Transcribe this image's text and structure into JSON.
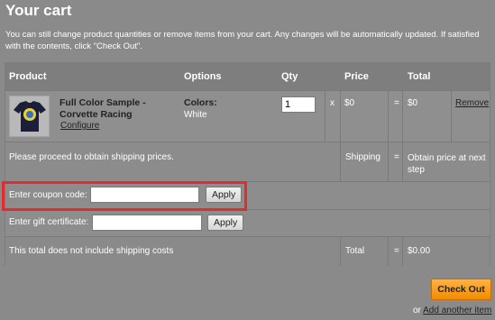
{
  "page": {
    "title": "Your cart",
    "intro": "You can still change product quantities or remove items from your cart. Any changes will be automatically updated. If satisfied with the contents, click \"Check Out\"."
  },
  "table": {
    "headers": {
      "product": "Product",
      "options": "Options",
      "qty": "Qty",
      "price": "Price",
      "total": "Total"
    },
    "item": {
      "name": "Full Color Sample - Corvette Racing",
      "configure": "Configure",
      "option_label": "Colors:",
      "option_value": "White",
      "qty": "1",
      "times": "x",
      "price": "$0",
      "equals": "=",
      "total": "$0",
      "remove": "Remove"
    },
    "shipping": {
      "message": "Please proceed to obtain shipping prices.",
      "label": "Shipping",
      "equals": "=",
      "value": "Obtain price at next step"
    },
    "coupon": {
      "label": "Enter coupon code:",
      "value": "",
      "apply": "Apply"
    },
    "gift": {
      "label": "Enter gift certificate:",
      "value": "",
      "apply": "Apply"
    },
    "total": {
      "note": "This total does not include shipping costs",
      "label": "Total",
      "equals": "=",
      "value": "$0.00"
    }
  },
  "actions": {
    "checkout": "Check Out",
    "or": "or",
    "add_another": "Add another item"
  },
  "colors": {
    "highlight": "#e52b2b",
    "checkout": "#f08c00"
  }
}
